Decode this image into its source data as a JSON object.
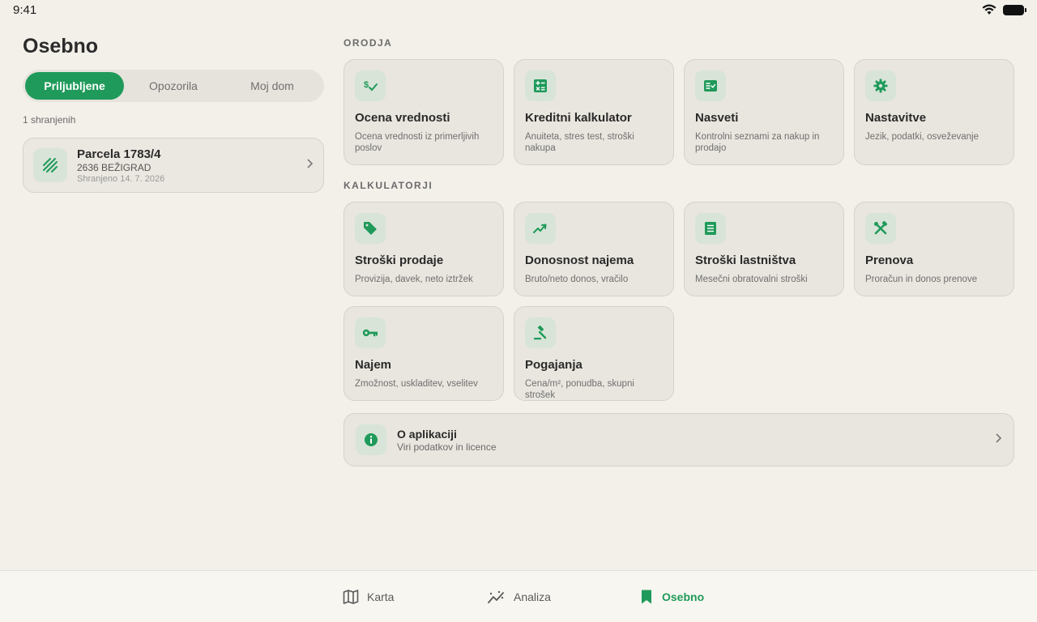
{
  "status": {
    "time": "9:41"
  },
  "page": {
    "title": "Osebno"
  },
  "tabs": [
    {
      "label": "Priljubljene",
      "active": true
    },
    {
      "label": "Opozorila",
      "active": false
    },
    {
      "label": "Moj dom",
      "active": false
    }
  ],
  "saved": {
    "count_label": "1 shranjenih",
    "items": [
      {
        "title": "Parcela 1783/4",
        "subtitle": "2636 BEŽIGRAD",
        "date": "Shranjeno 14. 7. 2026",
        "icon": "parcel-hatch-icon"
      }
    ]
  },
  "tools": {
    "label": "ORODJA",
    "cards": [
      {
        "title": "Ocena vrednosti",
        "subtitle": "Ocena vrednosti iz primerljivih poslov",
        "icon": "price-check-icon"
      },
      {
        "title": "Kreditni kalkulator",
        "subtitle": "Anuiteta, stres test, stroški nakupa",
        "icon": "calculator-icon"
      },
      {
        "title": "Nasveti",
        "subtitle": "Kontrolni seznami za nakup in prodajo",
        "icon": "checklist-icon"
      },
      {
        "title": "Nastavitve",
        "subtitle": "Jezik, podatki, osveževanje",
        "icon": "gear-icon"
      }
    ]
  },
  "calculators": {
    "label": "KALKULATORJI",
    "cards": [
      {
        "title": "Stroški prodaje",
        "subtitle": "Provizija, davek, neto iztržek",
        "icon": "tag-icon"
      },
      {
        "title": "Donosnost najema",
        "subtitle": "Bruto/neto donos, vračilo",
        "icon": "trend-up-icon"
      },
      {
        "title": "Stroški lastništva",
        "subtitle": "Mesečni obratovalni stroški",
        "icon": "receipt-icon"
      },
      {
        "title": "Prenova",
        "subtitle": "Proračun in donos prenove",
        "icon": "tools-icon"
      },
      {
        "title": "Najem",
        "subtitle": "Zmožnost, uskladitev, vselitev",
        "icon": "key-icon"
      },
      {
        "title": "Pogajanja",
        "subtitle": "Cena/m², ponudba, skupni strošek",
        "icon": "gavel-icon"
      }
    ]
  },
  "about": {
    "title": "O aplikaciji",
    "subtitle": "Viri podatkov in licence",
    "icon": "info-icon"
  },
  "nav": [
    {
      "label": "Karta",
      "icon": "map-icon",
      "active": false
    },
    {
      "label": "Analiza",
      "icon": "analytics-icon",
      "active": false
    },
    {
      "label": "Osebno",
      "icon": "bookmark-icon",
      "active": true
    }
  ],
  "colors": {
    "accent": "#1f9a5a",
    "background": "#f3f0ea",
    "card": "#e9e6df",
    "icon_bg": "#d8e4d8"
  }
}
